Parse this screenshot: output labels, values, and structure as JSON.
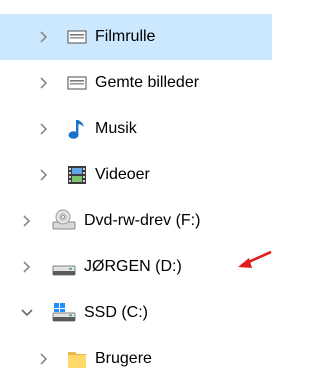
{
  "colors": {
    "selected_row": "#cce8ff",
    "chevron": "#8a8a8a",
    "annotation_arrow": "#e11d1d"
  },
  "tree": {
    "items": [
      {
        "label": "Filmrulle",
        "icon": "pictures-folder-icon",
        "state": "collapsed",
        "selected": true
      },
      {
        "label": "Gemte billeder",
        "icon": "pictures-folder-icon",
        "state": "collapsed"
      },
      {
        "label": "Musik",
        "icon": "music-folder-icon",
        "state": "collapsed"
      },
      {
        "label": "Videoer",
        "icon": "video-folder-icon",
        "state": "collapsed"
      },
      {
        "label": "Dvd-rw-drev (F:)",
        "icon": "dvd-drive-icon",
        "state": "collapsed"
      },
      {
        "label": "JØRGEN (D:)",
        "icon": "usb-drive-icon",
        "state": "collapsed"
      },
      {
        "label": "SSD (C:)",
        "icon": "windows-drive-icon",
        "state": "expanded"
      },
      {
        "label": "Brugere",
        "icon": "folder-icon",
        "state": "collapsed"
      }
    ]
  },
  "annotation": {
    "type": "red-arrow",
    "points_to": "JØRGEN (D:)"
  }
}
